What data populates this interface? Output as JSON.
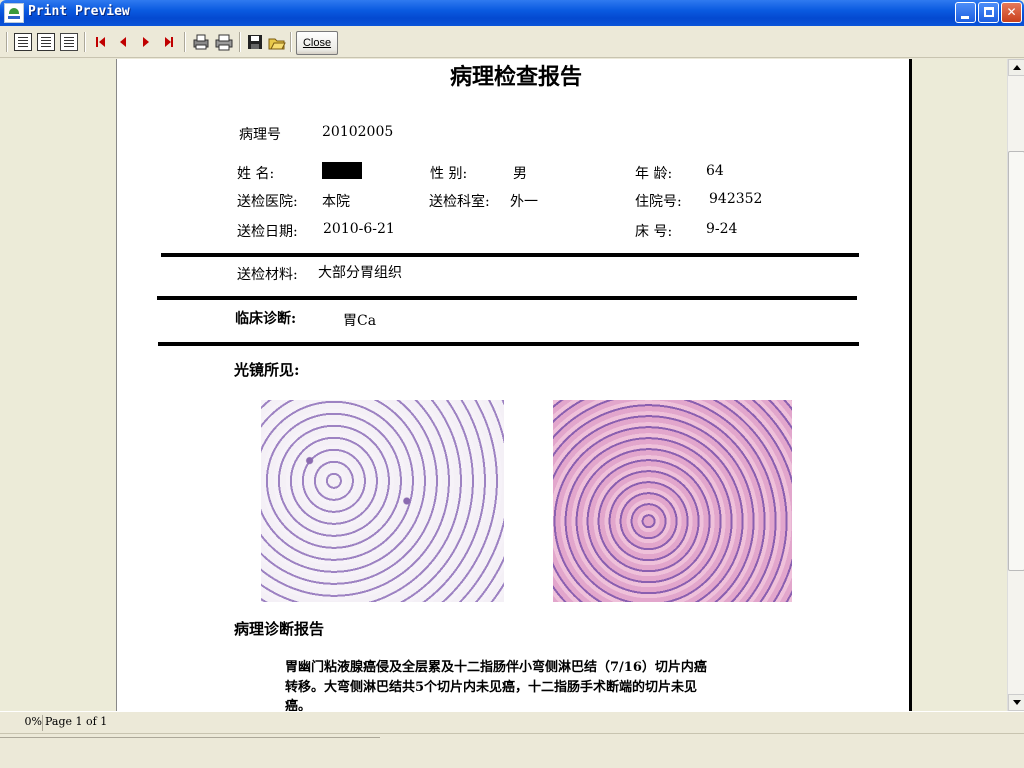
{
  "window": {
    "title": "Print Preview",
    "close_label": "Close"
  },
  "toolbar": {
    "icons": [
      "one-page-icon",
      "multi-page-icon",
      "page-setup-icon",
      "first-page-icon",
      "prev-page-icon",
      "next-page-icon",
      "last-page-icon",
      "print-setup-icon",
      "print-icon",
      "save-icon",
      "open-icon"
    ]
  },
  "report": {
    "title": "病理检查报告",
    "pathology_no_label": "病理号",
    "pathology_no": "20102005",
    "name_label": "姓   名:",
    "sex_label": "性   别:",
    "sex": "男",
    "age_label": "年   龄:",
    "age": "64",
    "hospital_label": "送检医院:",
    "hospital": "本院",
    "dept_label": "送检科室:",
    "dept": "外一",
    "inpatient_label": "住院号:",
    "inpatient_no": "942352",
    "date_label": "送检日期:",
    "date": "2010-6-21",
    "bed_label": "床   号:",
    "bed": "9-24",
    "material_label": "送检材料:",
    "material": "大部分胃组织",
    "clinical_label": "临床诊断:",
    "clinical": "胃Ca",
    "micro_label": "光镜所见:",
    "diag_label": "病理诊断报告",
    "diag_line1": "胃幽门粘液腺癌侵及全层累及十二指肠伴小弯侧淋巴结（7/16）切片内癌",
    "diag_line2": "转移。大弯侧淋巴结共5个切片内未见癌，十二指肠手术断端的切片未见",
    "diag_line3": "癌。"
  },
  "status": {
    "zoom": "0%",
    "page": "Page 1 of 1"
  }
}
